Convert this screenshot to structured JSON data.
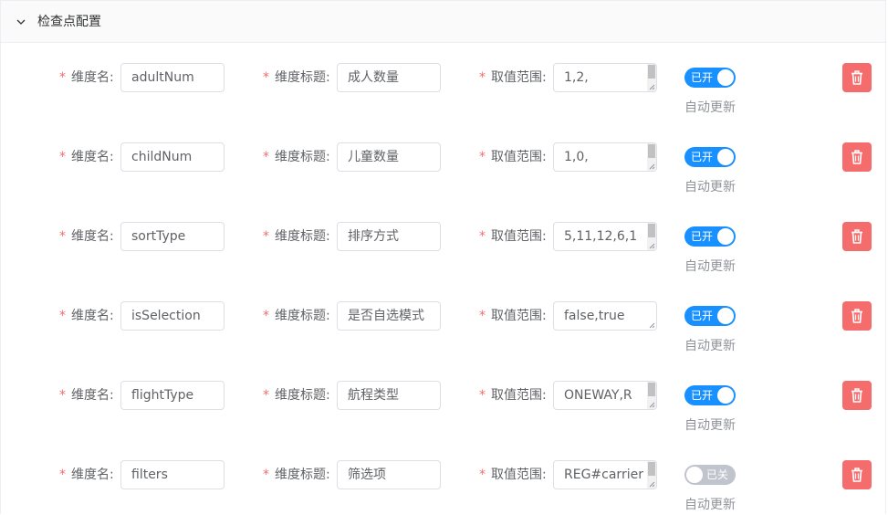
{
  "panel": {
    "title": "检查点配置"
  },
  "labels": {
    "required_mark": "*",
    "name": "维度名:",
    "title": "维度标题:",
    "range": "取值范围:",
    "auto_update": "自动更新"
  },
  "colors": {
    "primary": "#1890ff",
    "danger": "#f56c6c",
    "switch_off": "#c0c4cc"
  },
  "rows": [
    {
      "name": "adultNum",
      "title": "成人数量",
      "range": "1,2,",
      "switch_on": true,
      "switch_label": "已开",
      "has_scrollbar": true
    },
    {
      "name": "childNum",
      "title": "儿童数量",
      "range": "1,0,",
      "switch_on": true,
      "switch_label": "已开",
      "has_scrollbar": true
    },
    {
      "name": "sortType",
      "title": "排序方式",
      "range": "5,11,12,6,1",
      "switch_on": true,
      "switch_label": "已开",
      "has_scrollbar": true
    },
    {
      "name": "isSelection",
      "title": "是否自选模式",
      "range": "false,true",
      "switch_on": true,
      "switch_label": "已开",
      "has_scrollbar": false
    },
    {
      "name": "flightType",
      "title": "航程类型",
      "range": "ONEWAY,R",
      "switch_on": true,
      "switch_label": "已开",
      "has_scrollbar": true
    },
    {
      "name": "filters",
      "title": "筛选项",
      "range": "REG#carrier",
      "switch_on": false,
      "switch_label": "已关",
      "has_scrollbar": true
    }
  ]
}
